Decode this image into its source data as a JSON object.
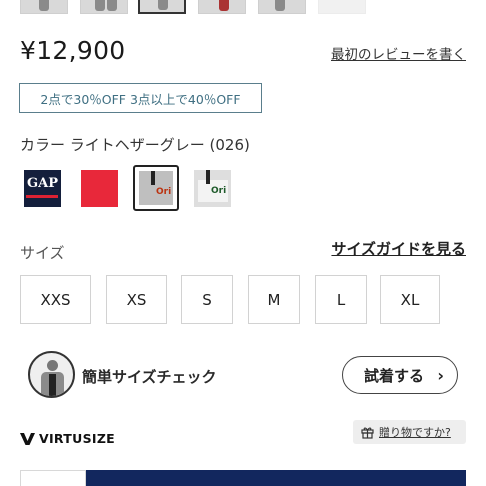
{
  "thumbnails": [
    {
      "name": "thumb-1",
      "active": false
    },
    {
      "name": "thumb-2",
      "active": false
    },
    {
      "name": "thumb-3",
      "active": true
    },
    {
      "name": "thumb-4",
      "active": false
    },
    {
      "name": "thumb-5",
      "active": false
    },
    {
      "name": "thumb-6",
      "active": false
    }
  ],
  "price": "¥12,900",
  "review_link": "最初のレビューを書く",
  "promo": "2点で30％OFF 3点以上で40％OFF",
  "color": {
    "label": "カラー ライトヘザーグレー (026)",
    "swatches": [
      {
        "name": "navy",
        "color": "#141f3c",
        "selected": false
      },
      {
        "name": "red",
        "color": "#e8283a",
        "selected": false
      },
      {
        "name": "light-heather-grey",
        "color": "#bfbfbf",
        "selected": true
      },
      {
        "name": "light-grey",
        "color": "#dedede",
        "selected": false
      }
    ],
    "swatch_text": {
      "gap": "GAP",
      "ori": "Ori"
    }
  },
  "size": {
    "label": "サイズ",
    "guide_link": "サイズガイドを見る",
    "options": [
      "XXS",
      "XS",
      "S",
      "M",
      "L",
      "XL"
    ]
  },
  "size_check": {
    "label": "簡単サイズチェック",
    "try_on_button": "試着する",
    "chevron": "›"
  },
  "virtusize": {
    "logo_text": "VIRTUSIZE"
  },
  "gift": {
    "label": "贈り物ですか?"
  },
  "colors": {
    "accent_navy": "#12275e",
    "promo_teal": "#3f6f82"
  }
}
